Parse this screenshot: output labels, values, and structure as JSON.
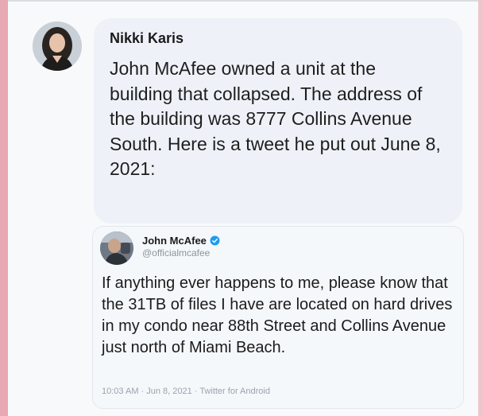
{
  "post": {
    "author_name": "Nikki Karis",
    "text": "John McAfee owned a unit at the building that collapsed. The address of the building was 8777 Collins Avenue South. Here is a tweet he put out June 8, 2021:"
  },
  "embedded_tweet": {
    "author_name": "John McAfee",
    "handle": "@officialmcafee",
    "text": "If anything ever happens to me, please know that the 31TB of files I have are located on hard drives in my condo near 88th Street and Collins Avenue just north of Miami Beach.",
    "meta": "10:03 AM · Jun 8, 2021 · Twitter for Android",
    "verified_color": "#1d9bf0"
  },
  "colors": {
    "left_bar": "#e7a9b2",
    "bubble_bg": "#eef2f8"
  }
}
